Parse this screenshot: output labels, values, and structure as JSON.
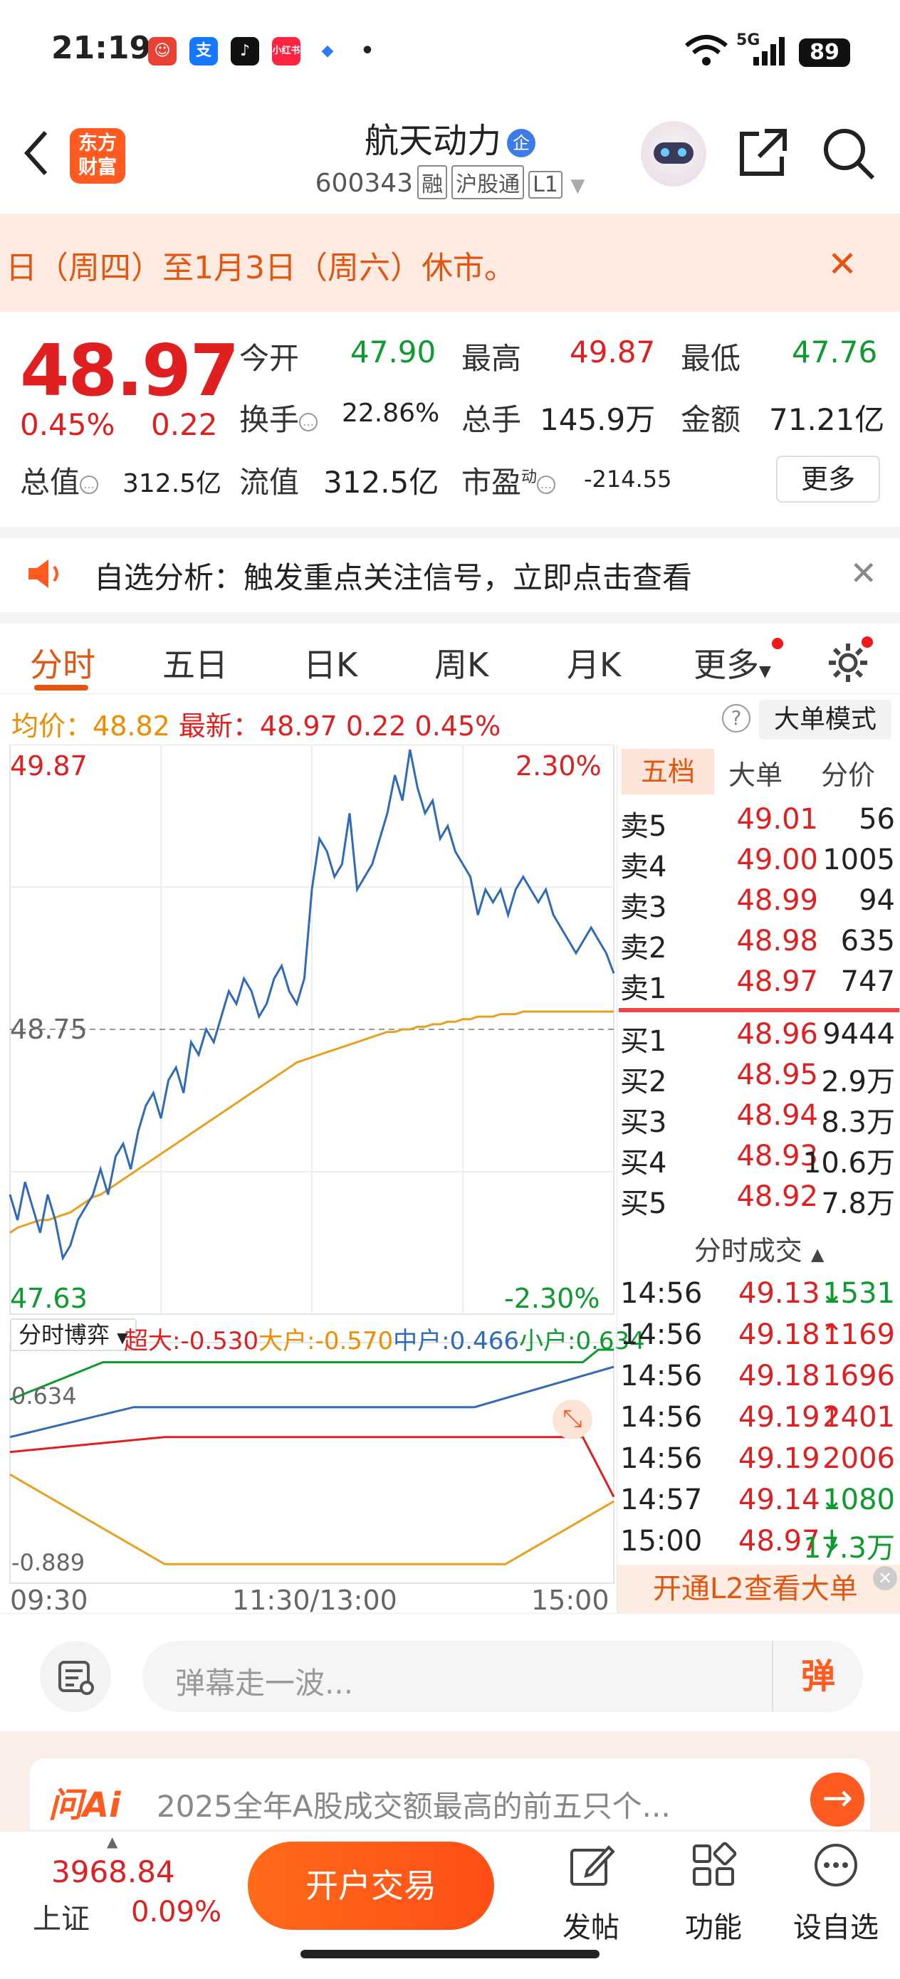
{
  "status": {
    "time": "21:19",
    "battery": "89",
    "network": "5G"
  },
  "header": {
    "logo_line1": "东方",
    "logo_line2": "财富",
    "stock_name": "航天动力",
    "badge": "企",
    "code": "600343",
    "tag1": "融",
    "tag2": "沪股通",
    "tag3": "L1"
  },
  "banner": {
    "text": "日（周四）至1月3日（周六）休市。"
  },
  "quote": {
    "price": "48.97",
    "change_pct": "0.45%",
    "change": "0.22",
    "open_label": "今开",
    "open": "47.90",
    "high_label": "最高",
    "high": "49.87",
    "low_label": "最低",
    "low": "47.76",
    "turnover_label": "换手",
    "turnover": "22.86%",
    "volume_label": "总手",
    "volume": "145.9万",
    "amount_label": "金额",
    "amount": "71.21亿",
    "mktcap_label": "总值",
    "mktcap": "312.5亿",
    "float_label": "流值",
    "float": "312.5亿",
    "pe_label": "市盈",
    "pe_sup": "动",
    "pe": "-214.55",
    "more": "更多"
  },
  "alert": {
    "text": "自选分析：触发重点关注信号，立即点击查看"
  },
  "tabs": [
    "分时",
    "五日",
    "日K",
    "周K",
    "月K",
    "更多"
  ],
  "avgline": {
    "avg_label": "均价：",
    "avg": "48.82",
    "latest_label": "最新：",
    "latest": "48.97",
    "chg": "0.22",
    "pct": "0.45%",
    "big_mode": "大单模式"
  },
  "chart_data": {
    "type": "line",
    "title": "",
    "y_top": "49.87",
    "y_mid": "48.75",
    "y_bottom": "47.63",
    "pct_top": "2.30%",
    "pct_bottom": "-2.30%",
    "ylim": [
      47.63,
      49.87
    ],
    "x_labels": [
      "09:30",
      "11:30/13:00",
      "15:00"
    ],
    "series": [
      {
        "values": [
          48.1,
          48.0,
          48.15,
          48.05,
          47.95,
          48.1,
          48.0,
          47.85,
          47.9,
          48.0,
          48.05,
          48.1,
          48.2,
          48.1,
          48.25,
          48.3,
          48.2,
          48.35,
          48.45,
          48.5,
          48.4,
          48.55,
          48.6,
          48.5,
          48.7,
          48.65,
          48.75,
          48.7,
          48.8,
          48.9,
          48.85,
          48.95,
          48.9,
          48.8,
          48.85,
          48.95,
          49.0,
          48.9,
          48.85,
          48.95,
          49.3,
          49.5,
          49.45,
          49.35,
          49.4,
          49.6,
          49.3,
          49.35,
          49.4,
          49.5,
          49.6,
          49.75,
          49.65,
          49.85,
          49.7,
          49.6,
          49.65,
          49.5,
          49.55,
          49.45,
          49.4,
          49.35,
          49.2,
          49.3,
          49.25,
          49.3,
          49.2,
          49.3,
          49.35,
          49.3,
          49.25,
          49.3,
          49.2,
          49.15,
          49.1,
          49.05,
          49.1,
          49.15,
          49.1,
          49.05,
          48.97
        ]
      },
      {
        "values": [
          47.95,
          47.97,
          47.98,
          47.99,
          48.0,
          48.0,
          48.01,
          48.02,
          48.03,
          48.05,
          48.07,
          48.09,
          48.1,
          48.12,
          48.14,
          48.16,
          48.18,
          48.2,
          48.22,
          48.24,
          48.26,
          48.28,
          48.3,
          48.32,
          48.34,
          48.36,
          48.38,
          48.4,
          48.42,
          48.44,
          48.46,
          48.48,
          48.5,
          48.52,
          48.54,
          48.56,
          48.58,
          48.6,
          48.62,
          48.63,
          48.64,
          48.65,
          48.66,
          48.67,
          48.68,
          48.69,
          48.7,
          48.71,
          48.72,
          48.73,
          48.74,
          48.74,
          48.75,
          48.75,
          48.76,
          48.76,
          48.77,
          48.77,
          48.78,
          48.78,
          48.79,
          48.79,
          48.8,
          48.8,
          48.8,
          48.81,
          48.81,
          48.81,
          48.82,
          48.82,
          48.82,
          48.82,
          48.82,
          48.82,
          48.82,
          48.82,
          48.82,
          48.82,
          48.82,
          48.82,
          48.82
        ]
      }
    ],
    "flow": {
      "selector": "分时博弈",
      "big_label": "超大:",
      "big": "-0.530",
      "large_label": "大户:",
      "large": "-0.570",
      "mid_label": "中户:",
      "mid": "0.466",
      "small_label": "小户:",
      "small": "0.634",
      "top": "0.634",
      "bottom": "-0.889",
      "ylim": [
        -0.889,
        0.634
      ]
    }
  },
  "book": {
    "tabs": [
      "五档",
      "大单",
      "分价"
    ],
    "asks": [
      {
        "label": "卖5",
        "price": "49.01",
        "vol": "56"
      },
      {
        "label": "卖4",
        "price": "49.00",
        "vol": "1005"
      },
      {
        "label": "卖3",
        "price": "48.99",
        "vol": "94"
      },
      {
        "label": "卖2",
        "price": "48.98",
        "vol": "635"
      },
      {
        "label": "卖1",
        "price": "48.97",
        "vol": "747"
      }
    ],
    "bids": [
      {
        "label": "买1",
        "price": "48.96",
        "vol": "9444"
      },
      {
        "label": "买2",
        "price": "48.95",
        "vol": "2.9万"
      },
      {
        "label": "买3",
        "price": "48.94",
        "vol": "8.3万"
      },
      {
        "label": "买4",
        "price": "48.93",
        "vol": "10.6万"
      },
      {
        "label": "买5",
        "price": "48.92",
        "vol": "7.8万"
      }
    ],
    "trades_title": "分时成交",
    "trades": [
      {
        "time": "14:56",
        "price": "49.13",
        "arrow": "↓",
        "vol": "1531"
      },
      {
        "time": "14:56",
        "price": "49.18",
        "arrow": "↑",
        "vol": "1169"
      },
      {
        "time": "14:56",
        "price": "49.18",
        "arrow": "",
        "vol": "1696"
      },
      {
        "time": "14:56",
        "price": "49.19",
        "arrow": "↑",
        "vol": "2401"
      },
      {
        "time": "14:56",
        "price": "49.19",
        "arrow": "",
        "vol": "2006"
      },
      {
        "time": "14:57",
        "price": "49.14",
        "arrow": "↓",
        "vol": "1080"
      },
      {
        "time": "15:00",
        "price": "48.97",
        "arrow": "↓",
        "vol": "17.3万"
      }
    ],
    "l2": "开通L2查看大单"
  },
  "comment": {
    "placeholder": "弹幕走一波...",
    "danmu": "弹"
  },
  "askai": {
    "logo": "问Ai",
    "text": "2025全年A股成交额最高的前五只个..."
  },
  "bottom": {
    "index_value": "3968.84",
    "index_name": "上证",
    "index_pct": "0.09%",
    "trade_btn": "开户交易",
    "nav": [
      "发帖",
      "功能",
      "设自选"
    ]
  },
  "colors": {
    "accent": "#ff5a1f",
    "up": "#e02020",
    "down": "#0d9a2e",
    "price_line": "#2f6bb8",
    "avg_line": "#e8a020"
  }
}
